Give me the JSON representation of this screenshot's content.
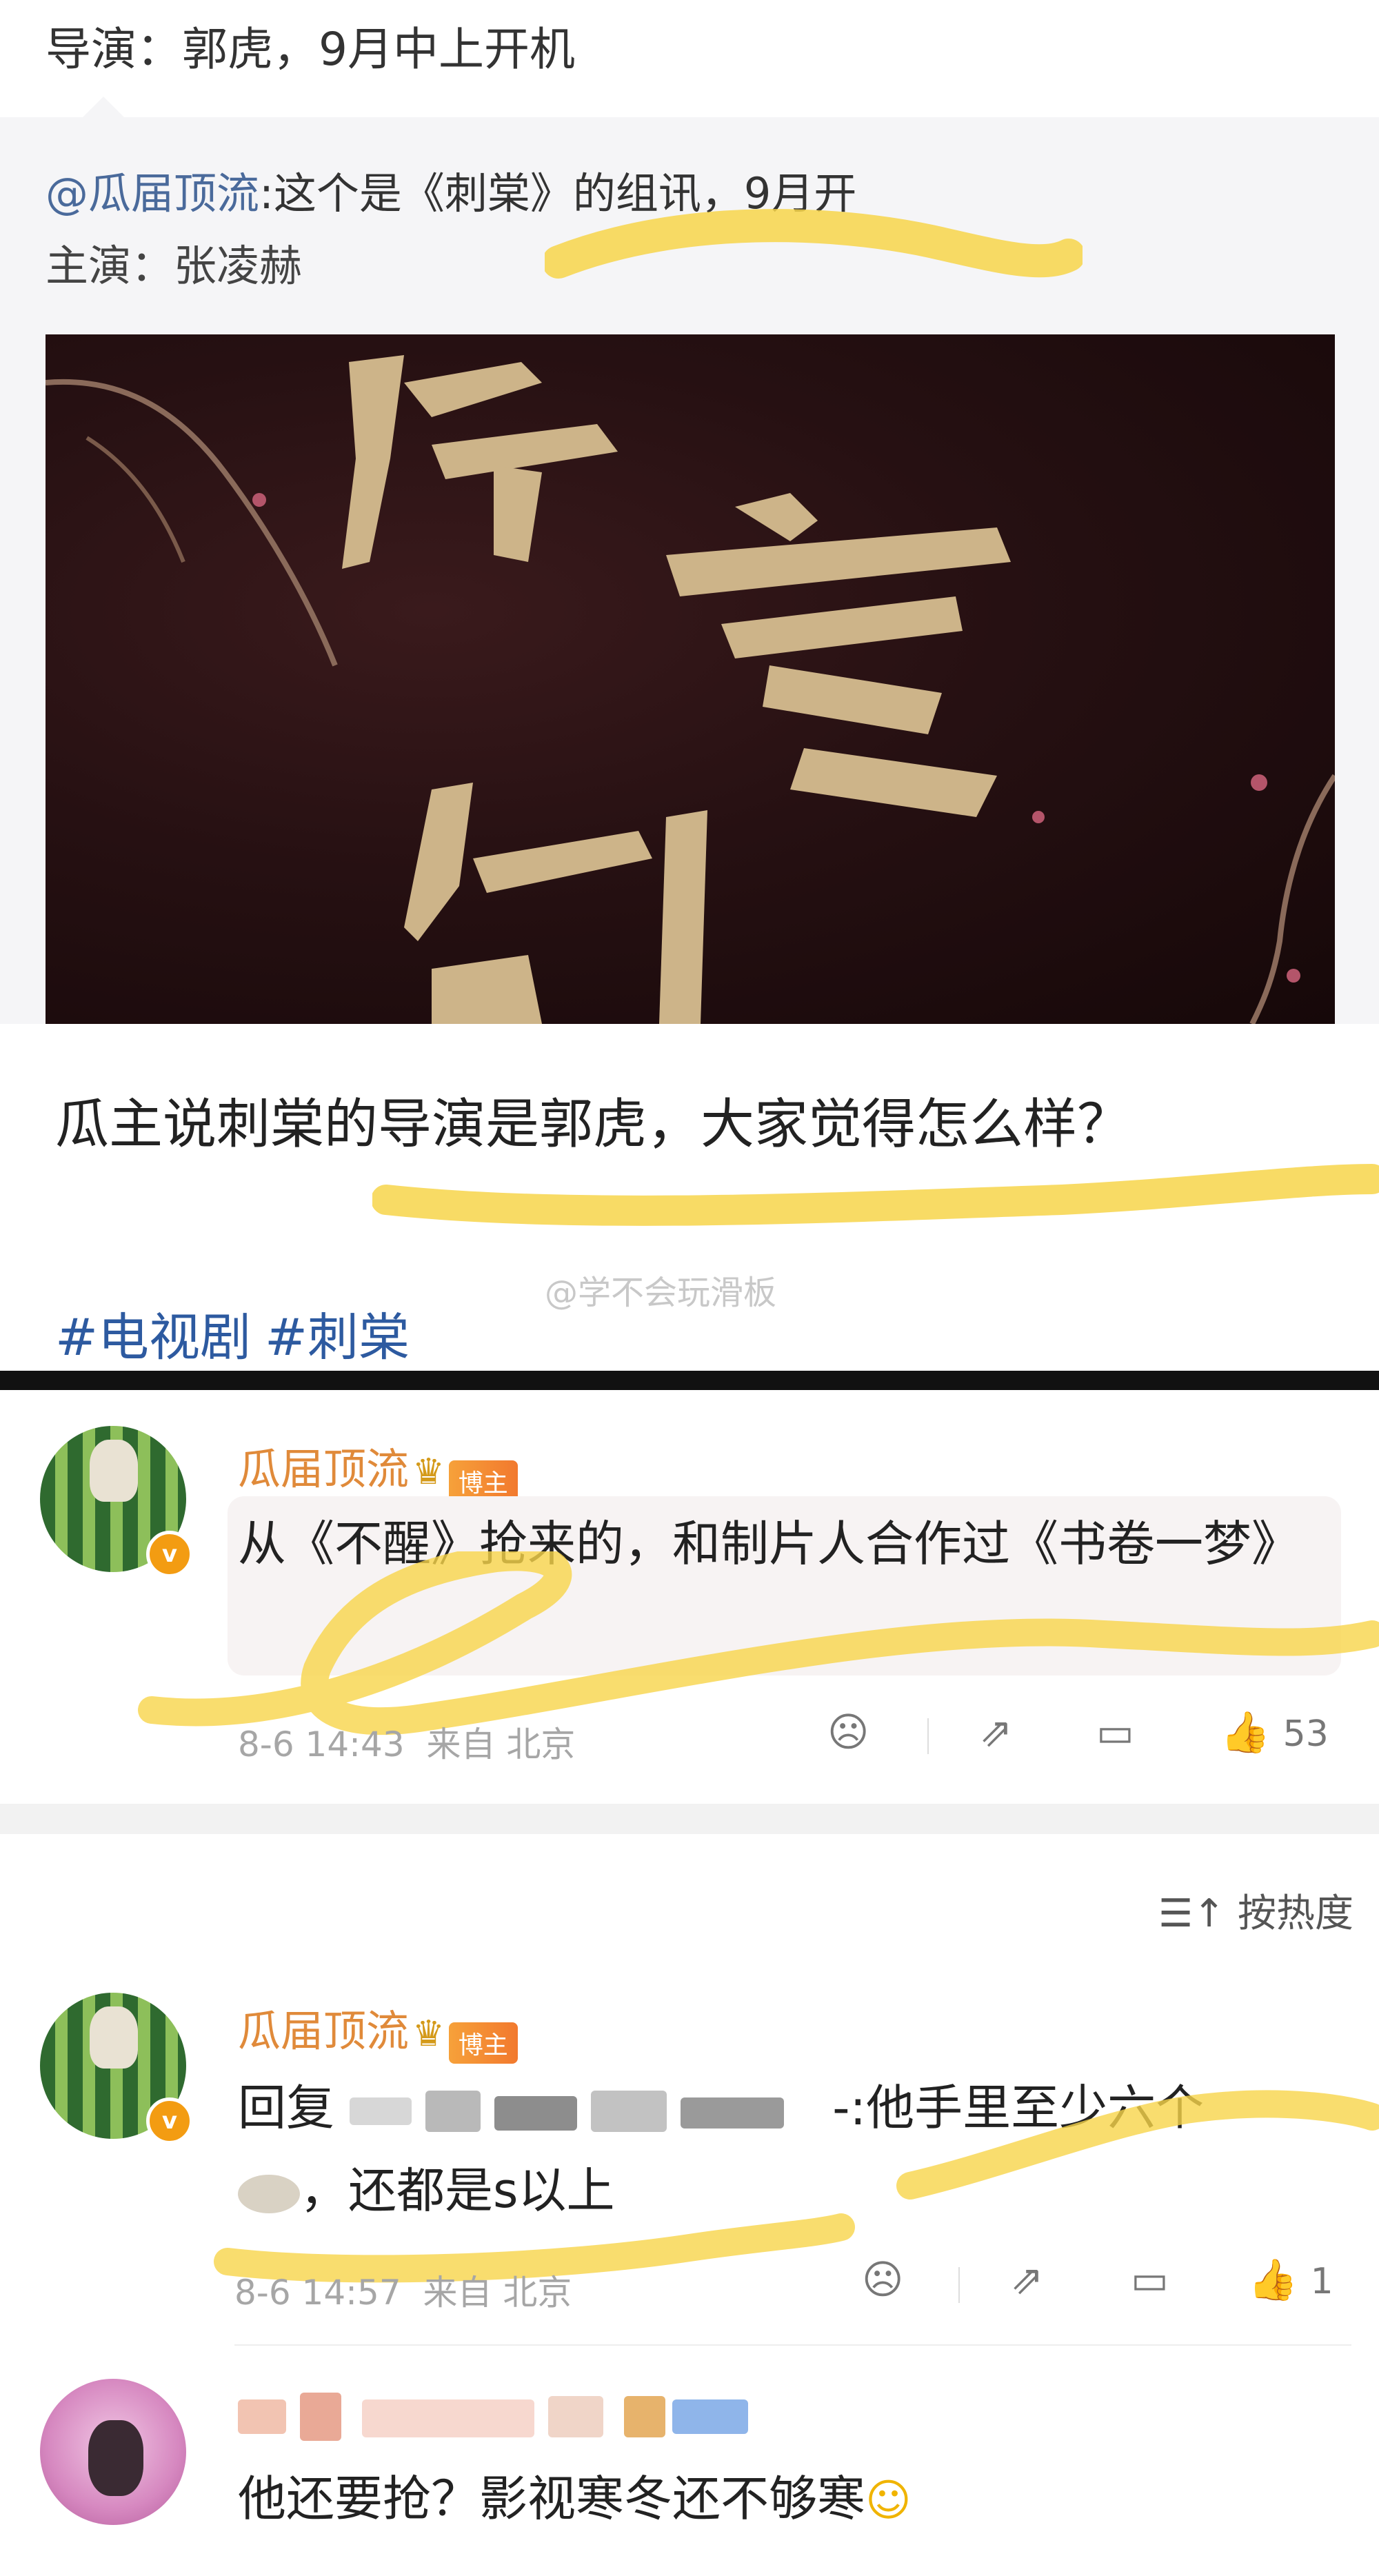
{
  "top": {
    "text": "导演：郭虎，9月中上开机"
  },
  "quote": {
    "mention": "@瓜届顶流",
    "text": ":这个是《刺棠》的组讯，9月开",
    "line2": "主演：张凌赫"
  },
  "post": {
    "text": "瓜主说刺棠的导演是郭虎，大家觉得怎么样？",
    "tags": [
      "#电视剧",
      "#刺棠"
    ],
    "watermark": "@学不会玩滑板"
  },
  "comments": [
    {
      "name": "瓜届顶流",
      "badge": "博主",
      "text": "从《不醒》抢来的，和制片人合作过《书卷一梦》",
      "time": "8-6 14:43",
      "location": "来自 北京",
      "likes": "53"
    },
    {
      "name": "瓜届顶流",
      "badge": "博主",
      "text_prefix": "回复",
      "text_mid": "-:他手里至少六个",
      "text_line2": "，还都是s以上",
      "time": "8-6 14:57",
      "location": "来自 北京",
      "likes": "1"
    },
    {
      "text": "他还要抢？影视寒冬还不够寒"
    }
  ],
  "sort": {
    "label": "按热度"
  },
  "icons": {
    "crown": "crown-icon",
    "sad": "sad-face-icon",
    "share": "share-icon",
    "comment": "comment-icon",
    "like": "thumbs-up-icon",
    "sort": "sort-icon"
  },
  "colors": {
    "highlight": "#f7d54a",
    "name": "#e08a3a",
    "tag": "#2d5aa0"
  }
}
